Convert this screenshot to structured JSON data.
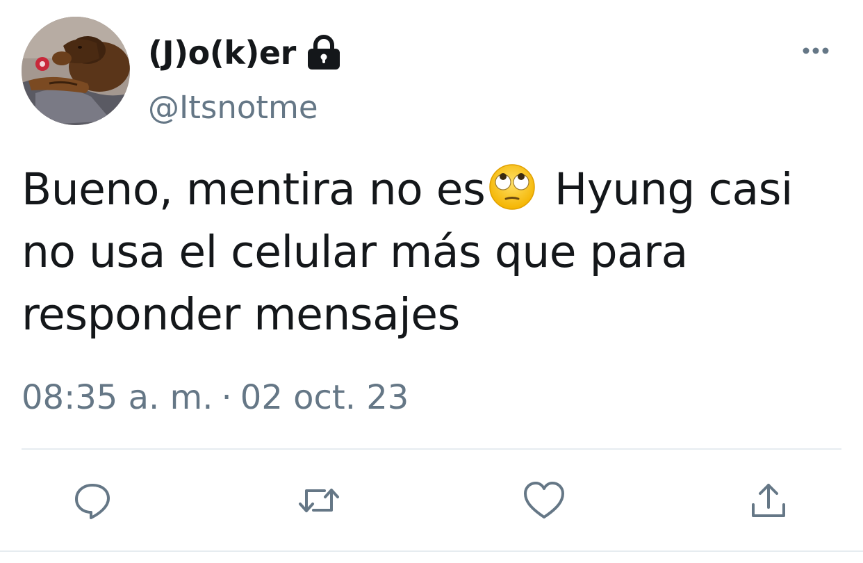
{
  "user": {
    "display_name": "(J)o(k)er",
    "handle": "@Itsnotme",
    "avatar_icon": "dog-photo",
    "protected_icon": "lock-icon"
  },
  "tweet": {
    "text_part1": "Bueno, mentira no es",
    "emoji": "face-with-rolling-eyes",
    "text_part2": " Hyung casi no usa el celular más que para responder mensajes",
    "time": "08:35 a. m.",
    "separator": "·",
    "date": "02 oct. 23"
  },
  "actions": [
    {
      "icon": "reply-icon"
    },
    {
      "icon": "retweet-icon"
    },
    {
      "icon": "like-icon"
    },
    {
      "icon": "share-icon"
    }
  ],
  "colors": {
    "text": "#14171a",
    "secondary": "#657786",
    "divider": "#e6ecf0",
    "icon": "#657786"
  }
}
